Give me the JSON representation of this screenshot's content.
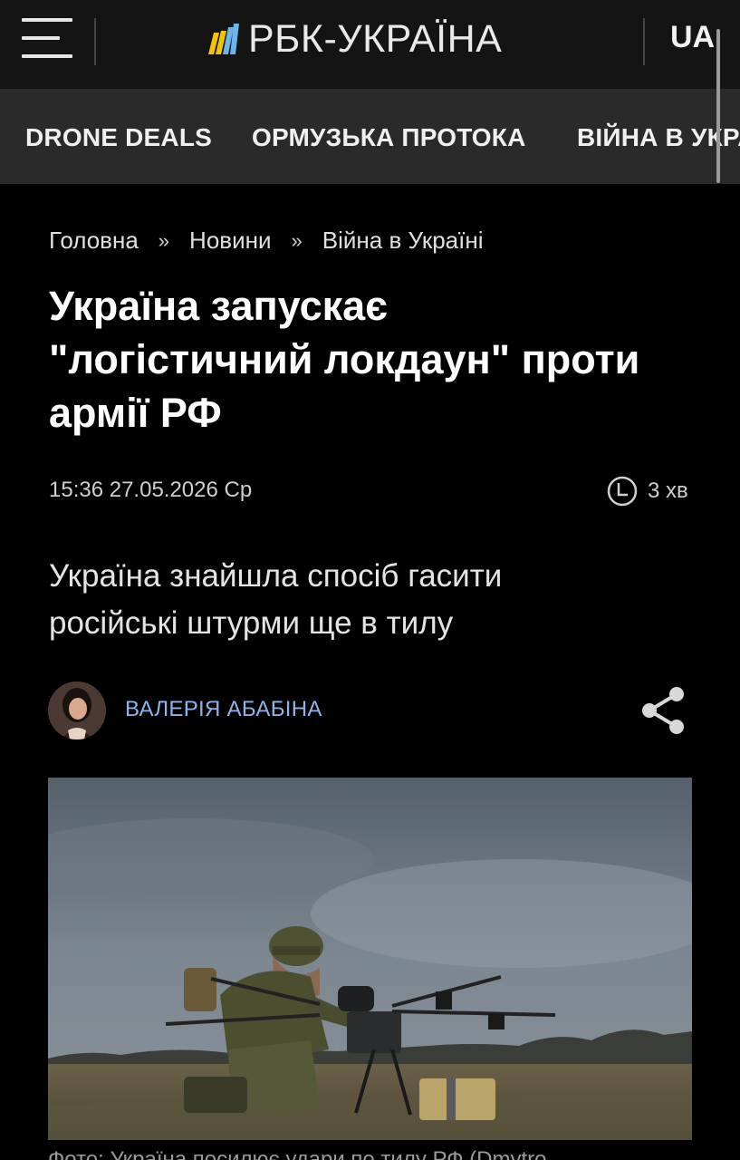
{
  "header": {
    "logo_text": "РБК-УКРАЇНА",
    "lang": "UA"
  },
  "nav": {
    "items": [
      "DRONE DEALS",
      "ОРМУЗЬКА ПРОТОКА",
      "ВІЙНА В УКРАЇНІ"
    ]
  },
  "breadcrumbs": {
    "items": [
      "Головна",
      "Новини",
      "Війна в Україні"
    ],
    "separator": "»"
  },
  "article": {
    "title_lines": [
      "Україна запускає",
      "\"логістичний локдаун\" проти",
      "армії РФ"
    ],
    "datetime": "15:36 27.05.2026 Ср",
    "read_time": "3 хв",
    "lead_lines": [
      "Україна знайшла спосіб гасити",
      "російські штурми ще в тилу"
    ],
    "author": "ВАЛЕРІЯ АБАБІНА",
    "caption": "Фото: Україна посилює удари по тилу РФ (Dmytro"
  },
  "colors": {
    "header_bg": "#141414",
    "nav_bg": "#2a2a2a",
    "page_bg": "#000000",
    "author_link": "#8fb4e8",
    "logo_yellow": "#f5c400",
    "logo_blue": "#6bb5e8"
  },
  "icons": {
    "menu": "hamburger-icon",
    "clock": "clock-icon",
    "share": "share-icon"
  }
}
